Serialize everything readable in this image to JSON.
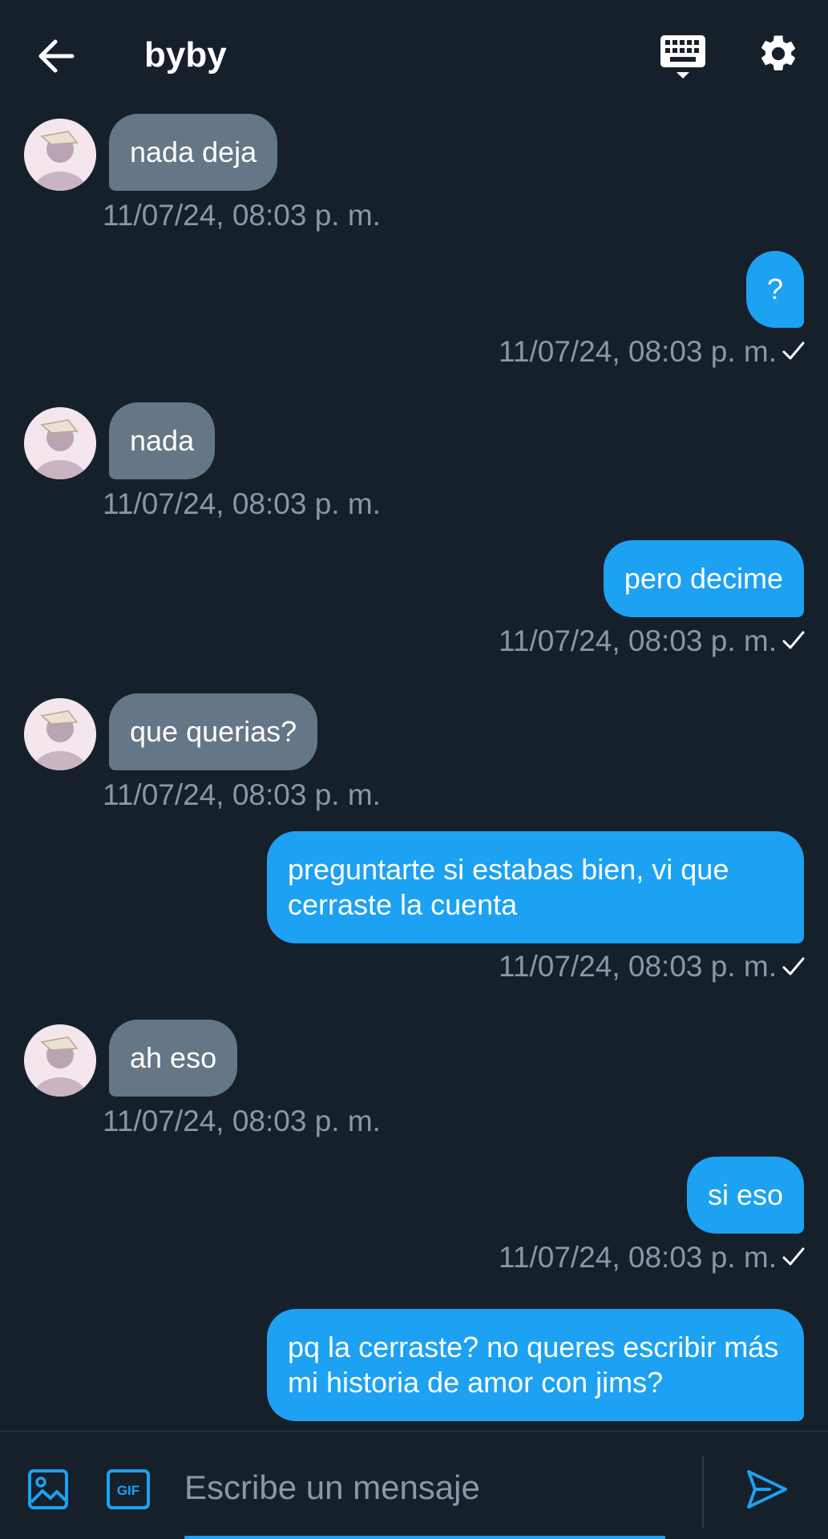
{
  "header": {
    "title": "byby",
    "icons": {
      "back": "arrow-left-icon",
      "keyboard": "keyboard-icon",
      "settings": "gear-icon"
    }
  },
  "messages": [
    {
      "direction": "in",
      "text": "nada deja",
      "timestamp": "11/07/24, 08:03 p. m."
    },
    {
      "direction": "out",
      "text": "?",
      "timestamp": "11/07/24, 08:03 p. m.",
      "read": true
    },
    {
      "direction": "in",
      "text": "nada",
      "timestamp": "11/07/24, 08:03 p. m."
    },
    {
      "direction": "out",
      "text": "pero decime",
      "timestamp": "11/07/24, 08:03 p. m.",
      "read": true
    },
    {
      "direction": "in",
      "text": "que querias?",
      "timestamp": "11/07/24, 08:03 p. m."
    },
    {
      "direction": "out",
      "text": "preguntarte si estabas bien, vi que cerraste la cuenta",
      "timestamp": "11/07/24, 08:03 p. m.",
      "read": true
    },
    {
      "direction": "in",
      "text": "ah eso",
      "timestamp": "11/07/24, 08:03 p. m."
    },
    {
      "direction": "out",
      "text": "si eso",
      "timestamp": "11/07/24, 08:03 p. m.",
      "read": true
    },
    {
      "direction": "out",
      "text": "pq la cerraste? no queres escribir más mi historia de amor con jims?"
    }
  ],
  "composer": {
    "placeholder": "Escribe un mensaje",
    "value": "",
    "gif_label": "GIF",
    "icons": {
      "image": "image-icon",
      "gif": "gif-icon",
      "send": "send-icon"
    }
  },
  "colors": {
    "background": "#15202b",
    "incoming_bubble": "#657786",
    "outgoing_bubble": "#1da1f2",
    "timestamp": "#8899a6",
    "accent": "#1da1f2"
  }
}
